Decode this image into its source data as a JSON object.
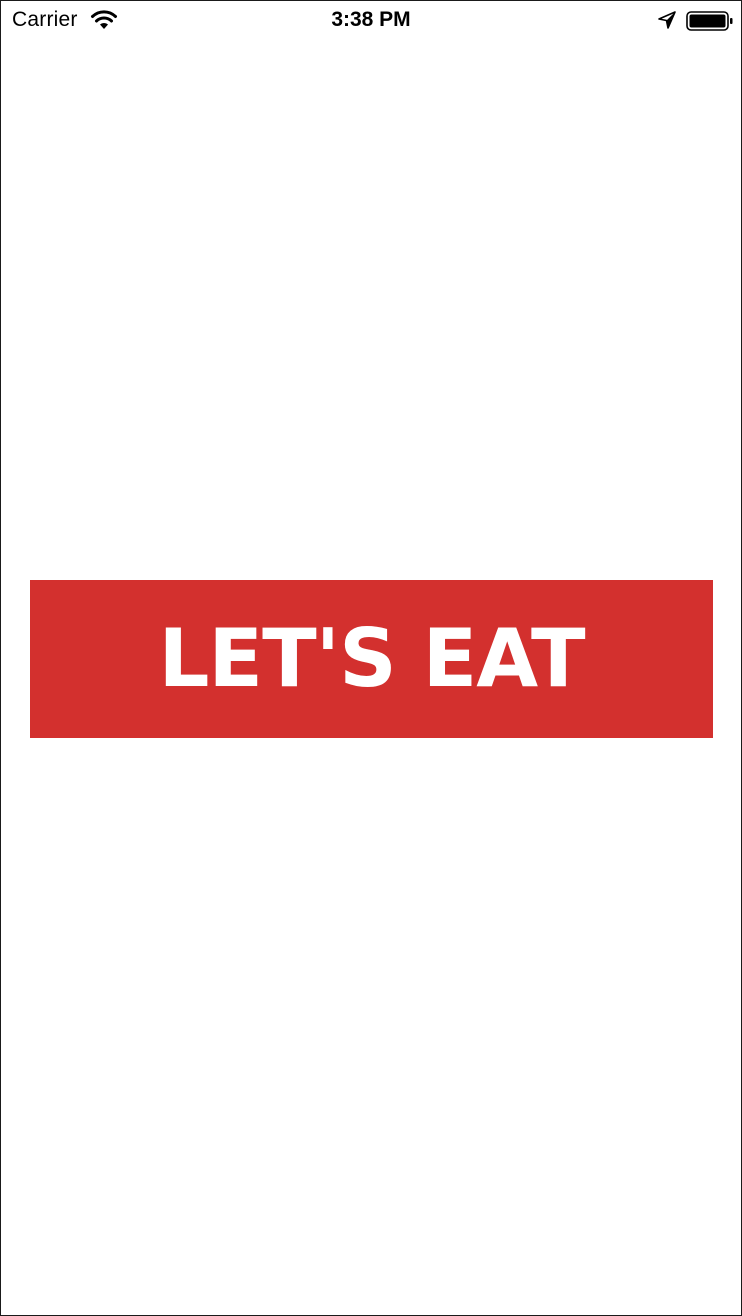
{
  "status_bar": {
    "carrier": "Carrier",
    "time": "3:38 PM",
    "wifi_icon": "wifi-icon",
    "location_icon": "location-arrow-icon",
    "battery_icon": "battery-full-icon"
  },
  "main": {
    "cta_label": "LET'S EAT"
  },
  "colors": {
    "accent": "#d3302e",
    "background": "#ffffff",
    "text_on_accent": "#ffffff"
  }
}
